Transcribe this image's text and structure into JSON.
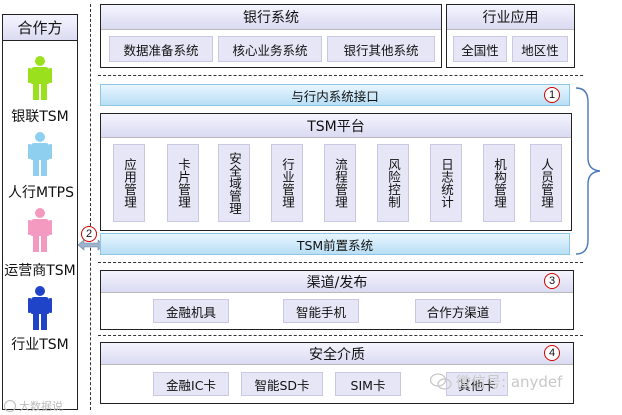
{
  "partners": {
    "title": "合作方",
    "items": [
      {
        "label": "银联TSM",
        "color": "#9be01c"
      },
      {
        "label": "人行MTPS",
        "color": "#8ecfef"
      },
      {
        "label": "运营商TSM",
        "color": "#f49ac0"
      },
      {
        "label": "行业TSM",
        "color": "#1f44c8"
      }
    ]
  },
  "bank_system": {
    "title": "银行系统",
    "items": [
      "数据准备系统",
      "核心业务系统",
      "银行其他系统"
    ]
  },
  "industry_app": {
    "title": "行业应用",
    "items": [
      "全国性",
      "地区性"
    ]
  },
  "interface": {
    "label": "与行内系统接口",
    "marker": "1"
  },
  "tsm": {
    "title": "TSM平台",
    "modules": [
      "应用管理",
      "卡片管理",
      "安全域管理",
      "行业管理",
      "流程管理",
      "风险控制",
      "日志统计",
      "机构管理",
      "人员管理"
    ]
  },
  "front": {
    "label": "TSM前置系统",
    "marker": "2"
  },
  "channel": {
    "title": "渠道/发布",
    "marker": "3",
    "items": [
      "金融机具",
      "智能手机",
      "合作方渠道"
    ]
  },
  "security": {
    "title": "安全介质",
    "marker": "4",
    "items": [
      "金融IC卡",
      "智能SD卡",
      "SIM卡",
      "其他卡"
    ]
  },
  "watermark": {
    "wechat": "微信号: anydef",
    "bottom_left": "大数据说"
  }
}
